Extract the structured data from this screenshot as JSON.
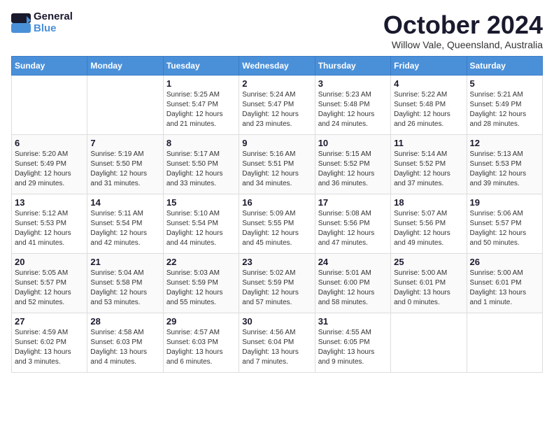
{
  "header": {
    "logo_text1": "General",
    "logo_text2": "Blue",
    "month": "October 2024",
    "location": "Willow Vale, Queensland, Australia"
  },
  "days_of_week": [
    "Sunday",
    "Monday",
    "Tuesday",
    "Wednesday",
    "Thursday",
    "Friday",
    "Saturday"
  ],
  "weeks": [
    [
      {
        "day": "",
        "sunrise": "",
        "sunset": "",
        "daylight": ""
      },
      {
        "day": "",
        "sunrise": "",
        "sunset": "",
        "daylight": ""
      },
      {
        "day": "1",
        "sunrise": "Sunrise: 5:25 AM",
        "sunset": "Sunset: 5:47 PM",
        "daylight": "Daylight: 12 hours and 21 minutes."
      },
      {
        "day": "2",
        "sunrise": "Sunrise: 5:24 AM",
        "sunset": "Sunset: 5:47 PM",
        "daylight": "Daylight: 12 hours and 23 minutes."
      },
      {
        "day": "3",
        "sunrise": "Sunrise: 5:23 AM",
        "sunset": "Sunset: 5:48 PM",
        "daylight": "Daylight: 12 hours and 24 minutes."
      },
      {
        "day": "4",
        "sunrise": "Sunrise: 5:22 AM",
        "sunset": "Sunset: 5:48 PM",
        "daylight": "Daylight: 12 hours and 26 minutes."
      },
      {
        "day": "5",
        "sunrise": "Sunrise: 5:21 AM",
        "sunset": "Sunset: 5:49 PM",
        "daylight": "Daylight: 12 hours and 28 minutes."
      }
    ],
    [
      {
        "day": "6",
        "sunrise": "Sunrise: 5:20 AM",
        "sunset": "Sunset: 5:49 PM",
        "daylight": "Daylight: 12 hours and 29 minutes."
      },
      {
        "day": "7",
        "sunrise": "Sunrise: 5:19 AM",
        "sunset": "Sunset: 5:50 PM",
        "daylight": "Daylight: 12 hours and 31 minutes."
      },
      {
        "day": "8",
        "sunrise": "Sunrise: 5:17 AM",
        "sunset": "Sunset: 5:50 PM",
        "daylight": "Daylight: 12 hours and 33 minutes."
      },
      {
        "day": "9",
        "sunrise": "Sunrise: 5:16 AM",
        "sunset": "Sunset: 5:51 PM",
        "daylight": "Daylight: 12 hours and 34 minutes."
      },
      {
        "day": "10",
        "sunrise": "Sunrise: 5:15 AM",
        "sunset": "Sunset: 5:52 PM",
        "daylight": "Daylight: 12 hours and 36 minutes."
      },
      {
        "day": "11",
        "sunrise": "Sunrise: 5:14 AM",
        "sunset": "Sunset: 5:52 PM",
        "daylight": "Daylight: 12 hours and 37 minutes."
      },
      {
        "day": "12",
        "sunrise": "Sunrise: 5:13 AM",
        "sunset": "Sunset: 5:53 PM",
        "daylight": "Daylight: 12 hours and 39 minutes."
      }
    ],
    [
      {
        "day": "13",
        "sunrise": "Sunrise: 5:12 AM",
        "sunset": "Sunset: 5:53 PM",
        "daylight": "Daylight: 12 hours and 41 minutes."
      },
      {
        "day": "14",
        "sunrise": "Sunrise: 5:11 AM",
        "sunset": "Sunset: 5:54 PM",
        "daylight": "Daylight: 12 hours and 42 minutes."
      },
      {
        "day": "15",
        "sunrise": "Sunrise: 5:10 AM",
        "sunset": "Sunset: 5:54 PM",
        "daylight": "Daylight: 12 hours and 44 minutes."
      },
      {
        "day": "16",
        "sunrise": "Sunrise: 5:09 AM",
        "sunset": "Sunset: 5:55 PM",
        "daylight": "Daylight: 12 hours and 45 minutes."
      },
      {
        "day": "17",
        "sunrise": "Sunrise: 5:08 AM",
        "sunset": "Sunset: 5:56 PM",
        "daylight": "Daylight: 12 hours and 47 minutes."
      },
      {
        "day": "18",
        "sunrise": "Sunrise: 5:07 AM",
        "sunset": "Sunset: 5:56 PM",
        "daylight": "Daylight: 12 hours and 49 minutes."
      },
      {
        "day": "19",
        "sunrise": "Sunrise: 5:06 AM",
        "sunset": "Sunset: 5:57 PM",
        "daylight": "Daylight: 12 hours and 50 minutes."
      }
    ],
    [
      {
        "day": "20",
        "sunrise": "Sunrise: 5:05 AM",
        "sunset": "Sunset: 5:57 PM",
        "daylight": "Daylight: 12 hours and 52 minutes."
      },
      {
        "day": "21",
        "sunrise": "Sunrise: 5:04 AM",
        "sunset": "Sunset: 5:58 PM",
        "daylight": "Daylight: 12 hours and 53 minutes."
      },
      {
        "day": "22",
        "sunrise": "Sunrise: 5:03 AM",
        "sunset": "Sunset: 5:59 PM",
        "daylight": "Daylight: 12 hours and 55 minutes."
      },
      {
        "day": "23",
        "sunrise": "Sunrise: 5:02 AM",
        "sunset": "Sunset: 5:59 PM",
        "daylight": "Daylight: 12 hours and 57 minutes."
      },
      {
        "day": "24",
        "sunrise": "Sunrise: 5:01 AM",
        "sunset": "Sunset: 6:00 PM",
        "daylight": "Daylight: 12 hours and 58 minutes."
      },
      {
        "day": "25",
        "sunrise": "Sunrise: 5:00 AM",
        "sunset": "Sunset: 6:01 PM",
        "daylight": "Daylight: 13 hours and 0 minutes."
      },
      {
        "day": "26",
        "sunrise": "Sunrise: 5:00 AM",
        "sunset": "Sunset: 6:01 PM",
        "daylight": "Daylight: 13 hours and 1 minute."
      }
    ],
    [
      {
        "day": "27",
        "sunrise": "Sunrise: 4:59 AM",
        "sunset": "Sunset: 6:02 PM",
        "daylight": "Daylight: 13 hours and 3 minutes."
      },
      {
        "day": "28",
        "sunrise": "Sunrise: 4:58 AM",
        "sunset": "Sunset: 6:03 PM",
        "daylight": "Daylight: 13 hours and 4 minutes."
      },
      {
        "day": "29",
        "sunrise": "Sunrise: 4:57 AM",
        "sunset": "Sunset: 6:03 PM",
        "daylight": "Daylight: 13 hours and 6 minutes."
      },
      {
        "day": "30",
        "sunrise": "Sunrise: 4:56 AM",
        "sunset": "Sunset: 6:04 PM",
        "daylight": "Daylight: 13 hours and 7 minutes."
      },
      {
        "day": "31",
        "sunrise": "Sunrise: 4:55 AM",
        "sunset": "Sunset: 6:05 PM",
        "daylight": "Daylight: 13 hours and 9 minutes."
      },
      {
        "day": "",
        "sunrise": "",
        "sunset": "",
        "daylight": ""
      },
      {
        "day": "",
        "sunrise": "",
        "sunset": "",
        "daylight": ""
      }
    ]
  ]
}
